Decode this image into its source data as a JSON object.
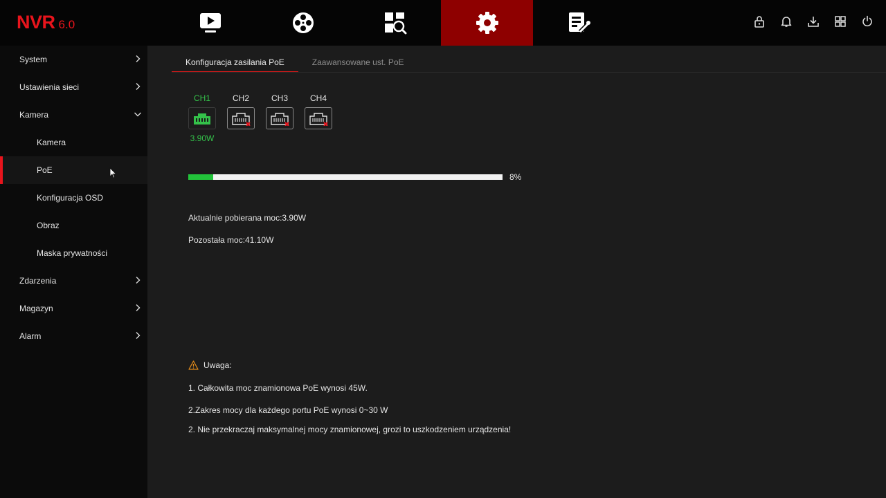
{
  "app": {
    "logo_text": "NVR",
    "logo_version": "6.0"
  },
  "colors": {
    "accent": "#e8141c",
    "active_nav_bg": "#8e0000",
    "poe_on": "#34c24a",
    "progress_fill": "#22c33a"
  },
  "top_nav": [
    {
      "icon": "playback-icon",
      "active": false
    },
    {
      "icon": "film-reel-icon",
      "active": false
    },
    {
      "icon": "search-grid-icon",
      "active": false
    },
    {
      "icon": "gear-icon",
      "active": true
    },
    {
      "icon": "maintenance-icon",
      "active": false
    }
  ],
  "system_icons": [
    "lock-icon",
    "bell-icon",
    "download-icon",
    "grid-icon",
    "power-icon"
  ],
  "sidebar": {
    "items": [
      {
        "label": "System",
        "level": 1,
        "chevron": "right"
      },
      {
        "label": "Ustawienia sieci",
        "level": 1,
        "chevron": "right"
      },
      {
        "label": "Kamera",
        "level": 1,
        "chevron": "down"
      },
      {
        "label": "Kamera",
        "level": 2
      },
      {
        "label": "PoE",
        "level": 2,
        "active": true
      },
      {
        "label": "Konfiguracja OSD",
        "level": 2
      },
      {
        "label": "Obraz",
        "level": 2
      },
      {
        "label": "Maska prywatności",
        "level": 2
      },
      {
        "label": "Zdarzenia",
        "level": 1,
        "chevron": "right"
      },
      {
        "label": "Magazyn",
        "level": 1,
        "chevron": "right"
      },
      {
        "label": "Alarm",
        "level": 1,
        "chevron": "right"
      }
    ]
  },
  "tabs": [
    {
      "label": "Konfiguracja zasilania PoE",
      "active": true
    },
    {
      "label": "Zaawansowane ust. PoE",
      "active": false
    }
  ],
  "channels": [
    {
      "label": "CH1",
      "connected": true,
      "power": "3.90W"
    },
    {
      "label": "CH2",
      "connected": false,
      "power": ""
    },
    {
      "label": "CH3",
      "connected": false,
      "power": ""
    },
    {
      "label": "CH4",
      "connected": false,
      "power": ""
    }
  ],
  "usage": {
    "percent": 8,
    "percent_label": "8%"
  },
  "info": {
    "current_power": "Aktualnie pobierana moc:3.90W",
    "remaining_power": "Pozostała moc:41.10W"
  },
  "notes": {
    "title": "Uwaga:",
    "lines": [
      "1. Całkowita moc znamionowa PoE wynosi 45W.",
      "2.Zakres mocy dla każdego portu PoE wynosi 0~30 W",
      "2. Nie przekraczaj maksymalnej mocy znamionowej, grozi to uszkodzeniem urządzenia!"
    ]
  }
}
